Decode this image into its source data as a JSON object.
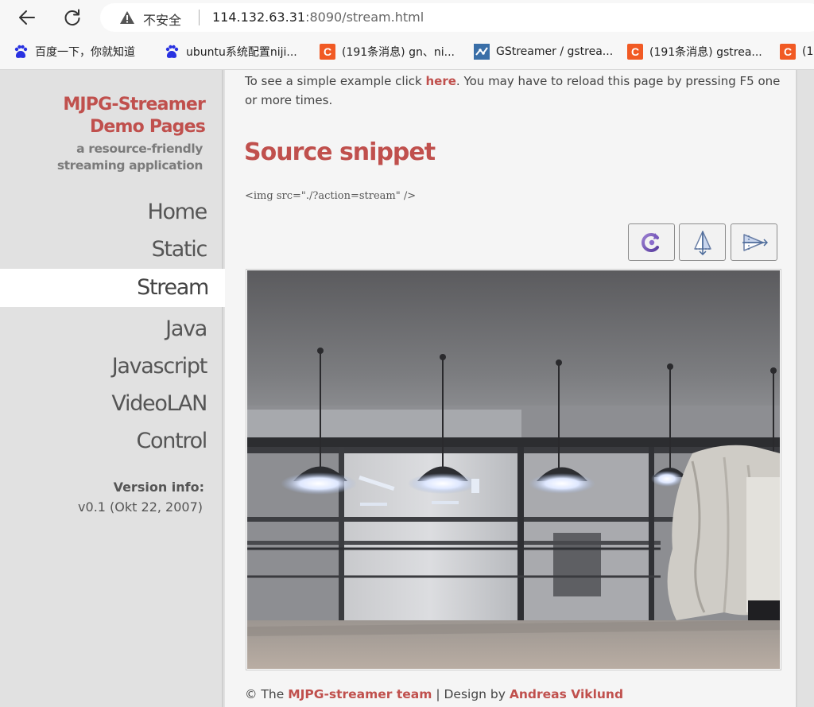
{
  "browser": {
    "security_label": "不安全",
    "url_host": "114.132.63.31",
    "url_rest": ":8090/stream.html",
    "bookmarks": [
      {
        "label": "百度一下，你就知道",
        "icon": "baidu-icon"
      },
      {
        "label": "ubuntu系统配置niji...",
        "icon": "baidu-icon"
      },
      {
        "label": "(191条消息) gn、ni...",
        "icon": "csdn-icon"
      },
      {
        "label": "GStreamer / gstrea...",
        "icon": "gstreamer-icon"
      },
      {
        "label": "(191条消息) gstrea...",
        "icon": "csdn-icon"
      },
      {
        "label": "(1",
        "icon": "csdn-icon"
      }
    ],
    "csdn_letter": "C"
  },
  "sidebar": {
    "title_line1": "MJPG-Streamer",
    "title_line2": "Demo Pages",
    "subtitle_line1": "a resource-friendly",
    "subtitle_line2": "streaming application",
    "nav": [
      "Home",
      "Static",
      "Stream",
      "Java",
      "Javascript",
      "VideoLAN",
      "Control"
    ],
    "active_nav": "Stream",
    "version_label": "Version info:",
    "version_value": "v0.1 (Okt 22, 2007)"
  },
  "content": {
    "intro_before": "To see a simple example click ",
    "intro_link": "here",
    "intro_after": ". You may have to reload this page by pressing F5 one or more times.",
    "section_title": "Source snippet",
    "snippet": "<img src=\"./?action=stream\" />",
    "tool_buttons": [
      {
        "name": "rotate-button",
        "icon": "rotate-icon"
      },
      {
        "name": "flip-vertical-button",
        "icon": "flip-vertical-icon"
      },
      {
        "name": "flip-horizontal-button",
        "icon": "flip-horizontal-icon"
      }
    ]
  },
  "footer": {
    "prefix": "© The ",
    "team_link": "MJPG-streamer team",
    "separator": " | Design by ",
    "designer_link": "Andreas Viklund"
  },
  "colors": {
    "accent": "#c0504d",
    "sidebar_bg": "#e1e1e1",
    "content_bg": "#f5f5f5"
  }
}
